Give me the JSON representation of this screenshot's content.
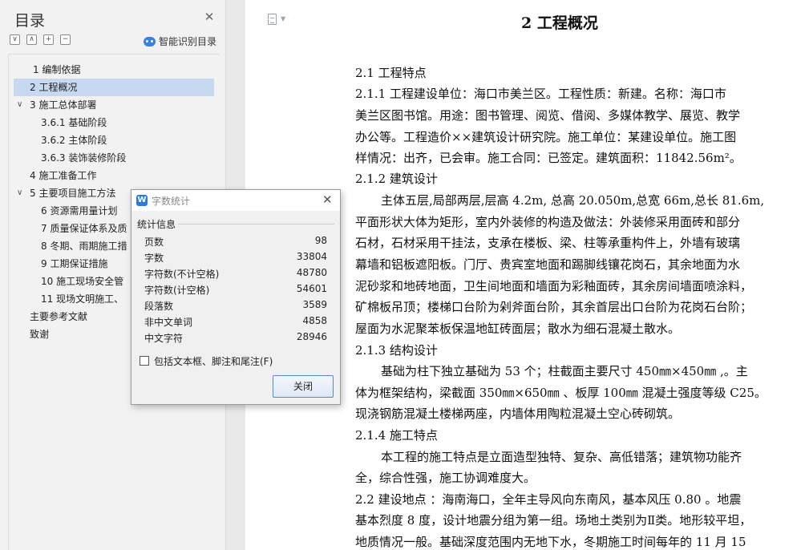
{
  "toc": {
    "title": "目录",
    "smart_toc_label": "智能识别目录",
    "items": [
      {
        "label": "1   编制依据",
        "active": false
      },
      {
        "label": "2   工程概况",
        "active": true
      },
      {
        "label": "3   施工总体部署",
        "caret": "∨"
      },
      {
        "label": "3.6.1  基础阶段"
      },
      {
        "label": "3.6.2  主体阶段"
      },
      {
        "label": "3.6.3  装饰装修阶段"
      },
      {
        "label": "4   施工准备工作"
      },
      {
        "label": "5   主要项目施工方法",
        "caret": "∨"
      },
      {
        "label": "6   资源需用量计划"
      },
      {
        "label": "7   质量保证体系及质"
      },
      {
        "label": "8   冬期、雨期施工措"
      },
      {
        "label": "9   工期保证措施"
      },
      {
        "label": "10   施工现场安全管"
      },
      {
        "label": "11   现场文明施工、"
      },
      {
        "label": "主要参考文献"
      },
      {
        "label": "致谢"
      }
    ]
  },
  "document": {
    "heading": "2   工程概况",
    "lines": [
      "2.1 工程特点",
      "2.1.1     工程建设单位：海口市美兰区。工程性质：新建。名称：海口市",
      "美兰区图书馆。用途：图书管理、阅览、借阅、多媒体教学、展览、教学",
      "办公等。工程造价××建筑设计研究院。施工单位：某建设单位。施工图",
      "样情况：出齐，已会审。施工合同：已签定。建筑面积：11842.56m²。",
      "2.1.2     建筑设计",
      "主体五层,局部两层,层高 4.2m, 总高 20.050m,总宽 66m,总长 81.6m,",
      "平面形状大体为矩形，室内外装修的构造及做法：外装修采用面砖和部分",
      "石材，石材采用干挂法，支承在楼板、梁、柱等承重构件上，外墙有玻璃",
      "幕墙和铝板遮阳板。门厅、贵宾室地面和踢脚线镶花岗石，其余地面为水",
      "泥砂浆和地砖地面，卫生间地面和墙面为彩釉面砖，其余房间墙面喷涂料，",
      "矿棉板吊顶；楼梯口台阶为剁斧面台阶，其余首层出口台阶为花岗石台阶；",
      "屋面为水泥聚苯板保温地缸砖面层；散水为细石混凝土散水。",
      "2.1.3     结构设计",
      "基础为柱下独立基础为 53 个；柱截面主要尺寸 450㎜×450㎜ ,。主",
      "体为框架结构，梁截面 350㎜×650㎜ 、板厚 100㎜ 混凝土强度等级 C25。",
      "现浇钢筋混凝土楼梯两座，内墙体用陶粒混凝土空心砖砌筑。",
      "2.1.4 施工特点",
      "本工程的施工特点是立面造型独特、复杂、高低错落；建筑物功能齐",
      "全，综合性强，施工协调难度大。",
      "2.2 建设地点 ：海南海口，全年主导风向东南风，基本风压 0.80 。地震",
      "基本烈度 8 度，设计地震分组为第一组。场地土类别为Ⅱ类。地形较平坦，",
      "地质情况一般。基础深度范围内无地下水，冬期施工时间每年的 11 月 15"
    ]
  },
  "dialog": {
    "title": "字数统计",
    "group_label": "统计信息",
    "stats": [
      {
        "label": "页数",
        "value": "98"
      },
      {
        "label": "字数",
        "value": "33804"
      },
      {
        "label": "字符数(不计空格)",
        "value": "48780"
      },
      {
        "label": "字符数(计空格)",
        "value": "54601"
      },
      {
        "label": "段落数",
        "value": "3589"
      },
      {
        "label": "非中文单词",
        "value": "4858"
      },
      {
        "label": "中文字符",
        "value": "28946"
      }
    ],
    "include_label": "包括文本框、脚注和尾注(F)",
    "include_checked": false,
    "close_label": "关闭"
  }
}
